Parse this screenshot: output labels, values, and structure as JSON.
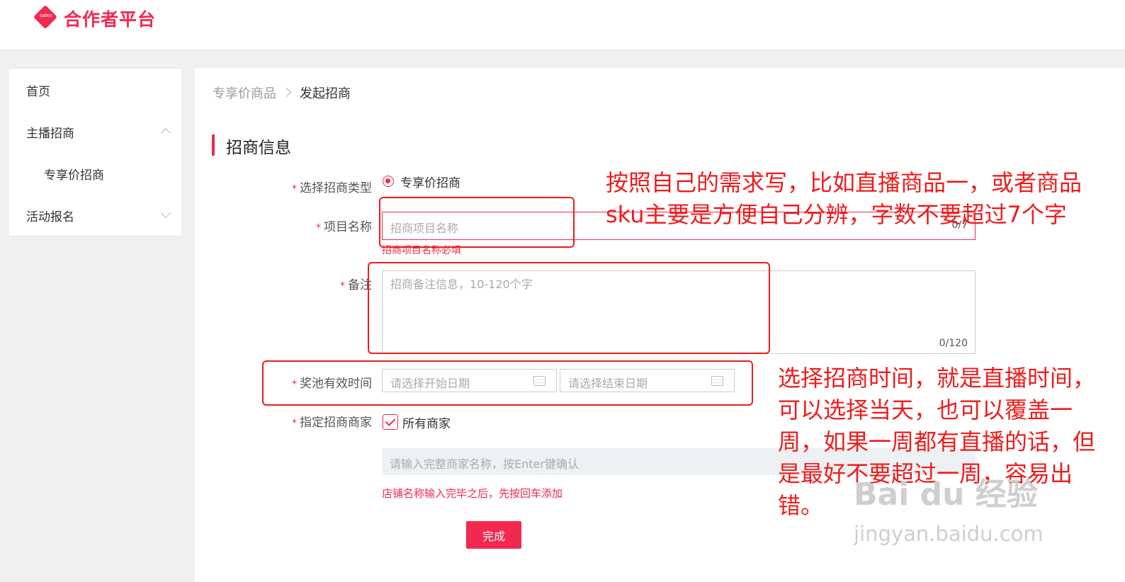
{
  "header": {
    "logo_badge": "sales",
    "title": "合作者平台"
  },
  "sidebar": {
    "items": [
      {
        "label": "首页"
      },
      {
        "label": "主播招商"
      },
      {
        "label": "专享价招商"
      },
      {
        "label": "活动报名"
      }
    ]
  },
  "breadcrumb": {
    "parent": "专享价商品",
    "current": "发起招商"
  },
  "section": {
    "title": "招商信息"
  },
  "form": {
    "required_mark": "*",
    "type_label": "选择招商类型",
    "type_option": "专享价招商",
    "name_label": "项目名称",
    "name_placeholder": "招商项目名称",
    "name_counter": "0/7",
    "name_error": "招商项目名称必填",
    "remark_label": "备注",
    "remark_placeholder": "招商备注信息，10-120个字",
    "remark_counter": "0/120",
    "time_label": "奖池有效时间",
    "start_placeholder": "请选择开始日期",
    "end_placeholder": "请选择结束日期",
    "merchant_label": "指定招商商家",
    "merchant_checkbox": "所有商家",
    "merchant_placeholder": "请输入完整商家名称，按Enter键确认",
    "merchant_hint": "店铺名称输入完毕之后，先按回车添加",
    "submit": "完成"
  },
  "annotations": {
    "note1": "按照自己的需求写，比如直播商品一，或者商品sku主要是方便自己分辨，字数不要超过7个字",
    "note2": "选择招商时间，就是直播时间，可以选择当天，也可以覆盖一周，如果一周都有直播的话，但是最好不要超过一周，容易出错。"
  },
  "watermark": {
    "brand": "Bai du 经验",
    "url": "jingyan.baidu.com"
  },
  "colors": {
    "accent": "#f2294f",
    "annotation": "#ee1c1c"
  }
}
